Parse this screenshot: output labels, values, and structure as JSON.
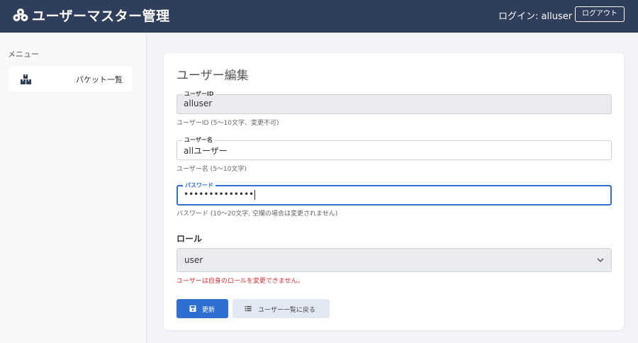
{
  "header": {
    "app_title": "ユーザーマスター管理",
    "login_text": "ログイン: alluser",
    "logout_label": "ログアウト"
  },
  "sidebar": {
    "menu_label": "メニュー",
    "items": [
      {
        "label": "パケット一覧",
        "icon": "boxes-icon"
      }
    ]
  },
  "form": {
    "heading": "ユーザー編集",
    "user_id": {
      "legend": "ユーザーID",
      "value": "alluser",
      "help": "ユーザーID (5～10文字、変更不可)"
    },
    "user_name": {
      "legend": "ユーザー名",
      "value": "allユーザー",
      "help": "ユーザー名 (5～10文字)"
    },
    "password": {
      "legend": "パスワード",
      "value": "••••••••••••••",
      "help": "パスワード (10～20文字, 空欄の場合は変更されません)"
    },
    "role": {
      "label": "ロール",
      "value": "user",
      "error": "ユーザーは自身のロールを変更できません。"
    },
    "buttons": {
      "update_label": "更新",
      "back_label": "ユーザー一覧に戻る"
    }
  },
  "colors": {
    "header_bg": "#2f3e5a",
    "primary": "#2f6fd1",
    "error": "#dd3333"
  }
}
